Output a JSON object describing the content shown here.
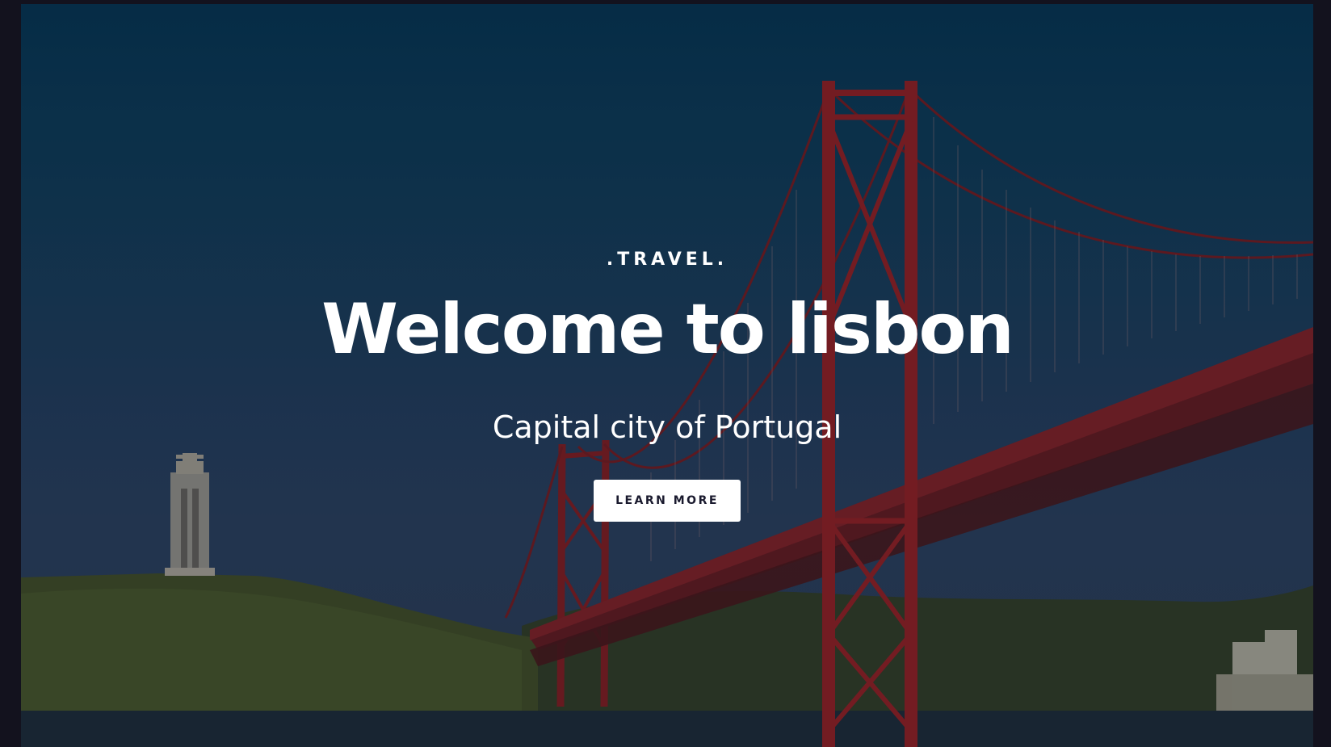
{
  "hero": {
    "eyebrow": ".TRAVEL.",
    "title": "Welcome to lisbon",
    "subtitle": "Capital city of Portugal",
    "cta_label": "LEARN MORE"
  },
  "background": {
    "image": "lisbon-bridge-photo",
    "sky_top": "#053350",
    "sky_bottom": "#283c5a",
    "bridge_color": "#8a1f24",
    "hill_color": "#3a4a2a",
    "water_color": "#1c2a38"
  }
}
